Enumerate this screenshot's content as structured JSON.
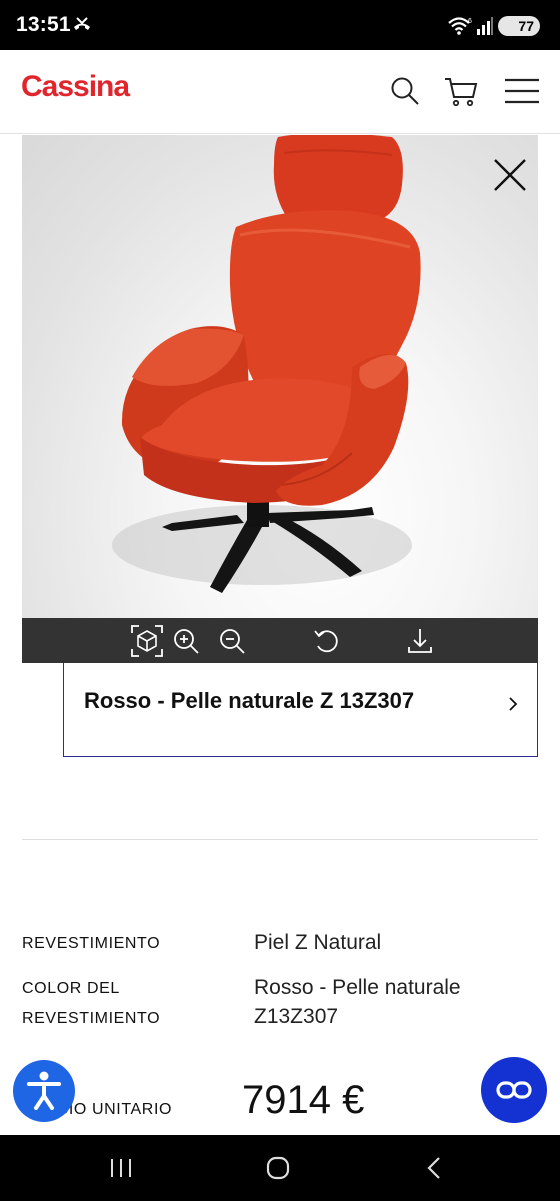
{
  "status_bar": {
    "time": "13:51",
    "battery": "77"
  },
  "header": {
    "logo": "Cassina",
    "icons": [
      "search-icon",
      "cart-icon",
      "menu-icon"
    ],
    "brand_color": "#e0262c"
  },
  "viewer": {
    "product_color": "#d83a1f",
    "toolbar_icons": [
      "ar-cube-icon",
      "zoom-in-icon",
      "zoom-out-icon",
      "reset-view-icon",
      "download-icon"
    ]
  },
  "variant": {
    "label": "Rosso - Pelle naturale Z 13Z307"
  },
  "specs": {
    "covering_label": "REVESTIMIENTO",
    "covering_value": "Piel Z Natural",
    "color_label_line1": "COLOR DEL",
    "color_label_line2": "REVESTIMIENTO",
    "color_value_line1": "Rosso - Pelle naturale",
    "color_value_line2": "Z13Z307",
    "price_label": "PRECIO UNITARIO",
    "price_value": "7914 €"
  },
  "floating": {
    "accessibility": "accessibility-icon",
    "chat": "chat-icon"
  },
  "nav_bar": {
    "icons": [
      "recent-apps-icon",
      "home-icon",
      "back-icon"
    ]
  }
}
